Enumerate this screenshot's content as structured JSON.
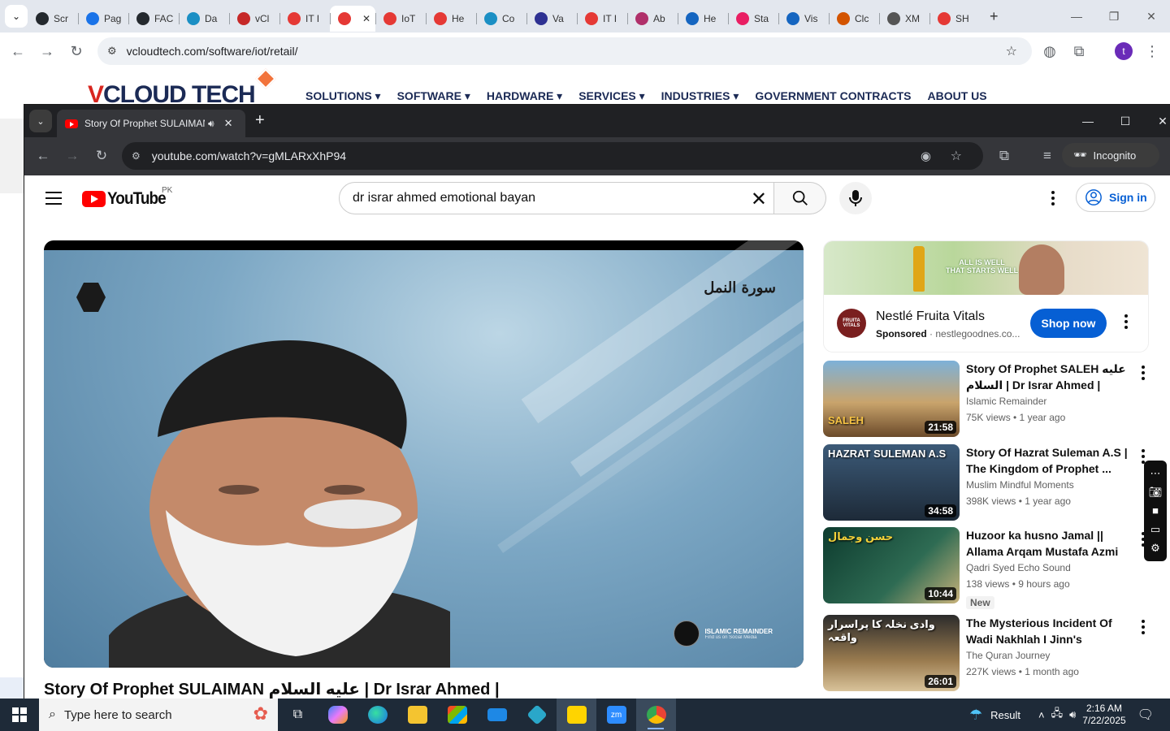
{
  "outer_browser": {
    "tabs": [
      {
        "label": "Scr",
        "icon": "github-icon",
        "color": "#24292e"
      },
      {
        "label": "Pag",
        "icon": "wifi-icon",
        "color": "#1a73e8"
      },
      {
        "label": "FAC",
        "icon": "github-icon",
        "color": "#24292e"
      },
      {
        "label": "Da",
        "icon": "swirl-icon",
        "color": "#1b8fc4"
      },
      {
        "label": "vCl",
        "icon": "vcloud-icon",
        "color": "#c62828"
      },
      {
        "label": "IT I",
        "icon": "vcloud-diamond-icon",
        "color": "#e53935"
      },
      {
        "label": "",
        "icon": "vcloud-diamond-icon",
        "color": "#e53935",
        "active": true
      },
      {
        "label": "IoT",
        "icon": "vcloud-diamond-icon",
        "color": "#e53935"
      },
      {
        "label": "He",
        "icon": "vcloud-diamond-icon",
        "color": "#e53935"
      },
      {
        "label": "Co",
        "icon": "swirl-icon",
        "color": "#1b8fc4"
      },
      {
        "label": "Va",
        "icon": "x-logo-icon",
        "color": "#2e3192"
      },
      {
        "label": "IT I",
        "icon": "vcloud-diamond-icon",
        "color": "#e53935"
      },
      {
        "label": "Ab",
        "icon": "flower-icon",
        "color": "#b0306a"
      },
      {
        "label": "He",
        "icon": "scales-icon",
        "color": "#1565c0"
      },
      {
        "label": "Sta",
        "icon": "pen-icon",
        "color": "#e91e63"
      },
      {
        "label": "Vis",
        "icon": "pulse-icon",
        "color": "#1565c0"
      },
      {
        "label": "Clc",
        "icon": "claude-icon",
        "color": "#d35400"
      },
      {
        "label": "XM",
        "icon": "globe-icon",
        "color": "#555555"
      },
      {
        "label": "SH",
        "icon": "circle-logo-icon",
        "color": "#e53935"
      }
    ],
    "url": "vcloudtech.com/software/iot/retail/"
  },
  "website": {
    "logo_v": "V",
    "logo_rest": "CLOUD TECH",
    "nav": [
      "SOLUTIONS ▾",
      "SOFTWARE ▾",
      "HARDWARE ▾",
      "SERVICES ▾",
      "INDUSTRIES ▾",
      "GOVERNMENT CONTRACTS",
      "ABOUT US"
    ]
  },
  "incognito": {
    "tab_title": "Story Of Prophet SULAIMAN",
    "url": "youtube.com/watch?v=gMLARxXhP94",
    "incognito_label": "Incognito"
  },
  "youtube": {
    "logo_text": "YouTube",
    "country_code": "PK",
    "search_value": "dr israr ahmed emotional bayan",
    "signin_label": "Sign in",
    "video": {
      "surah_text": "سورة النمل",
      "watermark": "ISLAMIC REMAINDER",
      "watermark_sub": "Find us on Social Media",
      "title": "Story Of Prophet SULAIMAN عليه السلام | Dr Israr Ahmed |"
    },
    "ad": {
      "banner_text_1": "ALL IS WELL",
      "banner_text_2": "THAT STARTS WELL",
      "logo_text": "FRUITA VITALS",
      "name": "Nestlé Fruita Vitals",
      "sponsored": "Sponsored",
      "domain": "· nestlegoodnes.co...",
      "cta": "Shop now"
    },
    "related": [
      {
        "title": "Story Of Prophet SALEH عليه السلام | Dr Israr Ahmed |",
        "channel": "Islamic Remainder",
        "meta": "75K views • 1 year ago",
        "duration": "21:58",
        "caption": "SALEH",
        "new": ""
      },
      {
        "title": "Story Of Hazrat Suleman A.S | The Kingdom of Prophet ...",
        "channel": "Muslim Mindful Moments",
        "meta": "398K views • 1 year ago",
        "duration": "34:58",
        "caption": "HAZRAT SULEMAN A.S",
        "new": ""
      },
      {
        "title": "Huzoor ka husno Jamal || Allama Arqam Mustafa Azmi ||...",
        "channel": "Qadri Syed Echo Sound",
        "meta": "138 views • 9 hours ago",
        "duration": "10:44",
        "caption": "حسن وجمال",
        "new": "New"
      },
      {
        "title": "The Mysterious Incident Of Wadi Nakhlah I Jinn's Listenin...",
        "channel": "The Quran Journey",
        "meta": "227K views • 1 month ago",
        "duration": "26:01",
        "caption": "وادی نخلہ کا پراسرار واقعہ",
        "new": ""
      }
    ]
  },
  "taskbar": {
    "search_placeholder": "Type here to search",
    "weather_label": "Result",
    "time": "2:16 AM",
    "date": "7/22/2025"
  }
}
